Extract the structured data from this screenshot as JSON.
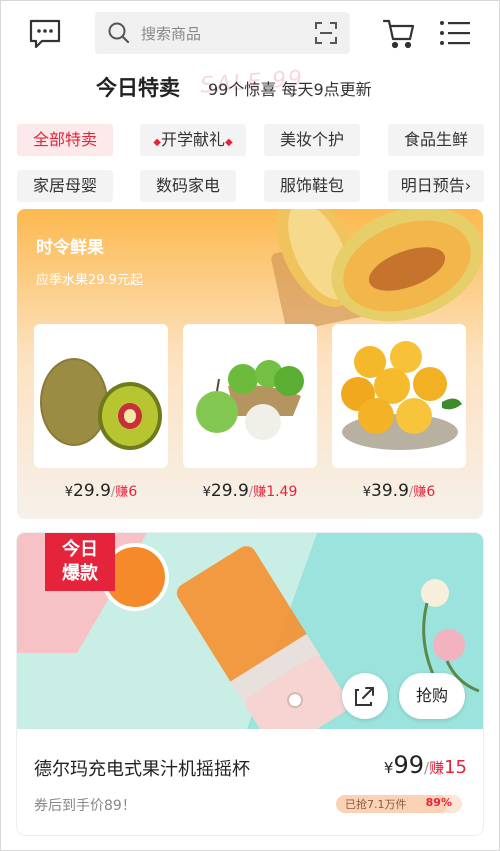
{
  "header": {
    "search_placeholder": "搜索商品",
    "icons": [
      "message-icon",
      "search-icon",
      "scan-icon",
      "cart-icon",
      "menu-icon"
    ]
  },
  "title": {
    "main": "今日特卖",
    "sub": "99个惊喜 每天9点更新",
    "watermark": "SALE 99"
  },
  "categories": [
    {
      "label": "全部特卖",
      "active": true
    },
    {
      "label": "开学献礼",
      "active": false
    },
    {
      "label": "美妆个护",
      "active": false
    },
    {
      "label": "食品生鲜",
      "active": false
    },
    {
      "label": "家居母婴",
      "active": false
    },
    {
      "label": "数码家电",
      "active": false
    },
    {
      "label": "服饰鞋包",
      "active": false
    },
    {
      "label": "明日预告›",
      "active": false
    }
  ],
  "fresh": {
    "title": "时令鲜果",
    "subtitle": "应季水果29.9元起",
    "items": [
      {
        "name": "kiwi",
        "yen": "¥",
        "price": "29.9",
        "slash": "/",
        "earn_label": "赚",
        "earn": "6"
      },
      {
        "name": "pear",
        "yen": "¥",
        "price": "29.9",
        "slash": "/",
        "earn_label": "赚",
        "earn": "1.49"
      },
      {
        "name": "peach",
        "yen": "¥",
        "price": "39.9",
        "slash": "/",
        "earn_label": "赚",
        "earn": "6"
      }
    ]
  },
  "deal": {
    "badge_line1": "今日",
    "badge_line2": "爆款",
    "buy_label": "抢购",
    "name": "德尔玛充电式果汁机摇摇杯",
    "yen": "¥",
    "price": "99",
    "slash": "/",
    "earn_label": "赚",
    "earn": "15",
    "coupon": "券后到手价89！",
    "sold_text": "已抢7.1万件",
    "sold_pct": "89%",
    "sold_fraction": 0.89
  },
  "colors": {
    "accent": "#e5243b",
    "fresh_top": "#fcb94f",
    "chip_bg": "#f3f3f3"
  }
}
